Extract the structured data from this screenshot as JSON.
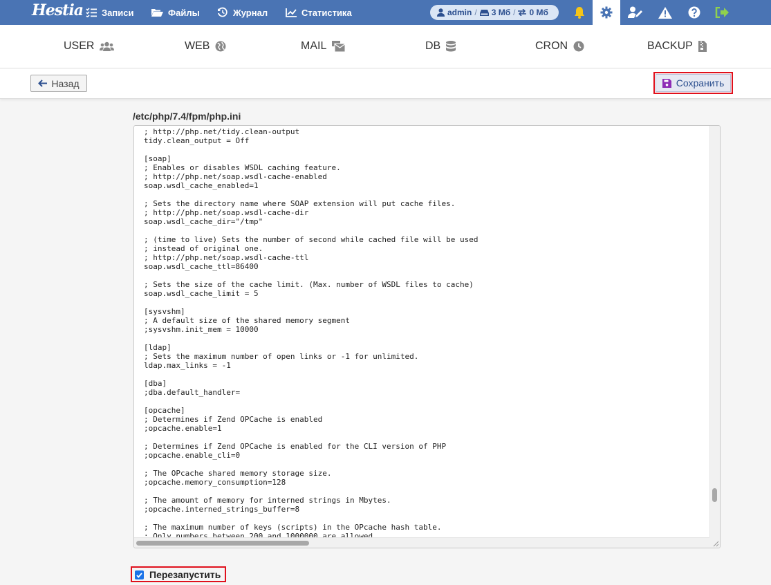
{
  "app": {
    "logo_text": "Hestia"
  },
  "topnav": {
    "records": "Записи",
    "files": "Файлы",
    "journal": "Журнал",
    "stats": "Статистика"
  },
  "user": {
    "name": "admin",
    "sep": "/",
    "disk": "3 Мб",
    "traffic": "0 Мб"
  },
  "sections": {
    "user": "USER",
    "web": "WEB",
    "mail": "MAIL",
    "db": "DB",
    "cron": "CRON",
    "backup": "BACKUP"
  },
  "toolbar": {
    "back_label": "Назад",
    "save_label": "Сохранить"
  },
  "editor": {
    "path": "/etc/php/7.4/fpm/php.ini",
    "content": "; http://php.net/tidy.clean-output\ntidy.clean_output = Off\n\n[soap]\n; Enables or disables WSDL caching feature.\n; http://php.net/soap.wsdl-cache-enabled\nsoap.wsdl_cache_enabled=1\n\n; Sets the directory name where SOAP extension will put cache files.\n; http://php.net/soap.wsdl-cache-dir\nsoap.wsdl_cache_dir=\"/tmp\"\n\n; (time to live) Sets the number of second while cached file will be used\n; instead of original one.\n; http://php.net/soap.wsdl-cache-ttl\nsoap.wsdl_cache_ttl=86400\n\n; Sets the size of the cache limit. (Max. number of WSDL files to cache)\nsoap.wsdl_cache_limit = 5\n\n[sysvshm]\n; A default size of the shared memory segment\n;sysvshm.init_mem = 10000\n\n[ldap]\n; Sets the maximum number of open links or -1 for unlimited.\nldap.max_links = -1\n\n[dba]\n;dba.default_handler=\n\n[opcache]\n; Determines if Zend OPCache is enabled\n;opcache.enable=1\n\n; Determines if Zend OPCache is enabled for the CLI version of PHP\n;opcache.enable_cli=0\n\n; The OPcache shared memory storage size.\n;opcache.memory_consumption=128\n\n; The amount of memory for interned strings in Mbytes.\n;opcache.interned_strings_buffer=8\n\n; The maximum number of keys (scripts) in the OPcache hash table.\n; Only numbers between 200 and 1000000 are allowed."
  },
  "restart": {
    "label": "Перезапустить",
    "checked": true
  },
  "colors": {
    "topbar": "#4a74b4",
    "bell": "#f5c518",
    "logout": "#8fd14f",
    "highlight": "#e0101c",
    "save_icon": "#8e2db6"
  }
}
